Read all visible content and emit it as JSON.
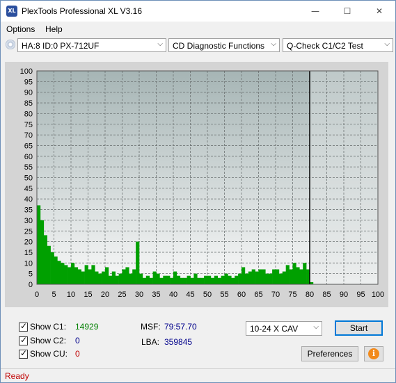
{
  "window": {
    "title": "PlexTools Professional XL V3.16",
    "app_icon": "XL",
    "minimize": "—",
    "maximize": "☐",
    "close": "✕"
  },
  "menu": [
    {
      "label": "Options"
    },
    {
      "label": "Help"
    }
  ],
  "toolbar": {
    "drive": "HA:8 ID:0  PX-712UF",
    "function": "CD Diagnostic Functions",
    "test": "Q-Check C1/C2 Test"
  },
  "chart_data": {
    "type": "bar",
    "title": "",
    "xlabel": "",
    "ylabel": "",
    "xlim": [
      0,
      100
    ],
    "ylim": [
      0,
      100
    ],
    "x_ticks": [
      0,
      5,
      10,
      15,
      20,
      25,
      30,
      35,
      40,
      45,
      50,
      55,
      60,
      65,
      70,
      75,
      80,
      85,
      90,
      95,
      100
    ],
    "y_ticks": [
      0,
      5,
      10,
      15,
      20,
      25,
      30,
      35,
      40,
      45,
      50,
      55,
      60,
      65,
      70,
      75,
      80,
      85,
      90,
      95,
      100
    ],
    "grid": true,
    "end_marker_x": 80,
    "series": [
      {
        "color": "#00a000",
        "x": [
          0,
          1,
          2,
          3,
          4,
          5,
          6,
          7,
          8,
          9,
          10,
          11,
          12,
          13,
          14,
          15,
          16,
          17,
          18,
          19,
          20,
          21,
          22,
          23,
          24,
          25,
          26,
          27,
          28,
          29,
          30,
          31,
          32,
          33,
          34,
          35,
          36,
          37,
          38,
          39,
          40,
          41,
          42,
          43,
          44,
          45,
          46,
          47,
          48,
          49,
          50,
          51,
          52,
          53,
          54,
          55,
          56,
          57,
          58,
          59,
          60,
          61,
          62,
          63,
          64,
          65,
          66,
          67,
          68,
          69,
          70,
          71,
          72,
          73,
          74,
          75,
          76,
          77,
          78,
          79,
          80
        ],
        "values": [
          37,
          30,
          23,
          18,
          15,
          13,
          11,
          10,
          9,
          8,
          10,
          8,
          7,
          6,
          9,
          7,
          9,
          6,
          5,
          6,
          8,
          4,
          6,
          4,
          5,
          7,
          8,
          5,
          7,
          20,
          5,
          3,
          4,
          3,
          6,
          5,
          3,
          4,
          4,
          3,
          6,
          4,
          3,
          3,
          4,
          3,
          5,
          3,
          3,
          4,
          4,
          3,
          4,
          3,
          4,
          5,
          4,
          3,
          4,
          5,
          8,
          5,
          6,
          7,
          6,
          7,
          7,
          5,
          5,
          7,
          7,
          5,
          6,
          9,
          7,
          10,
          8,
          7,
          10,
          7,
          1
        ]
      }
    ]
  },
  "stats": {
    "c1_label": "Show C1:",
    "c1_value": "14929",
    "c2_label": "Show C2:",
    "c2_value": "0",
    "cu_label": "Show CU:",
    "cu_value": "0",
    "msf_label": "MSF:",
    "msf_value": "79:57.70",
    "lba_label": "LBA:",
    "lba_value": "359845",
    "c1_color": "#008000",
    "c2_color": "#00008b",
    "cu_color": "#c00000"
  },
  "controls": {
    "speed": "10-24 X CAV",
    "start": "Start",
    "preferences": "Preferences",
    "info_icon": "i"
  },
  "status": {
    "text": "Ready"
  }
}
